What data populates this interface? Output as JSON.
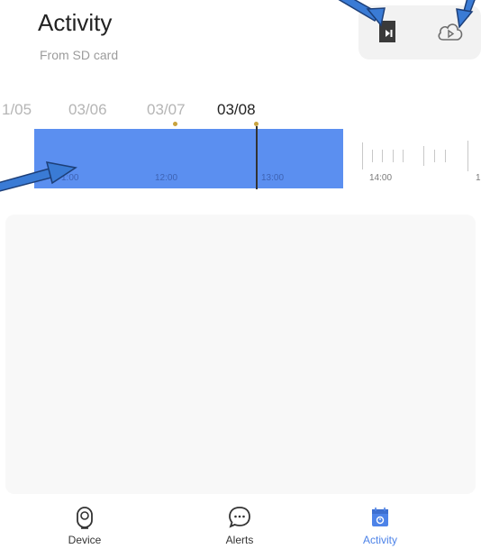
{
  "header": {
    "title": "Activity",
    "subtitle": "From SD card"
  },
  "source_toggle": {
    "selected": "sd-card",
    "sd_icon": "sd-card-icon",
    "cloud_icon": "cloud-play-icon"
  },
  "date_strip": {
    "dates": [
      "1/05",
      "03/06",
      "03/07",
      "03/08"
    ],
    "selected": "03/08",
    "dot_color": "#c9a33e"
  },
  "timeline": {
    "tick_labels": [
      "1:00",
      "12:00",
      "13:00",
      "14:00",
      "1"
    ],
    "recorded_color": "#5b8ff0"
  },
  "tabbar": {
    "tabs": [
      {
        "label": "Device",
        "icon": "camera-icon"
      },
      {
        "label": "Alerts",
        "icon": "chat-bubble-icon"
      },
      {
        "label": "Activity",
        "icon": "calendar-icon"
      }
    ],
    "active": "Activity",
    "accent_color": "#4d83e8"
  },
  "annotation_color": "#3a7bd5"
}
